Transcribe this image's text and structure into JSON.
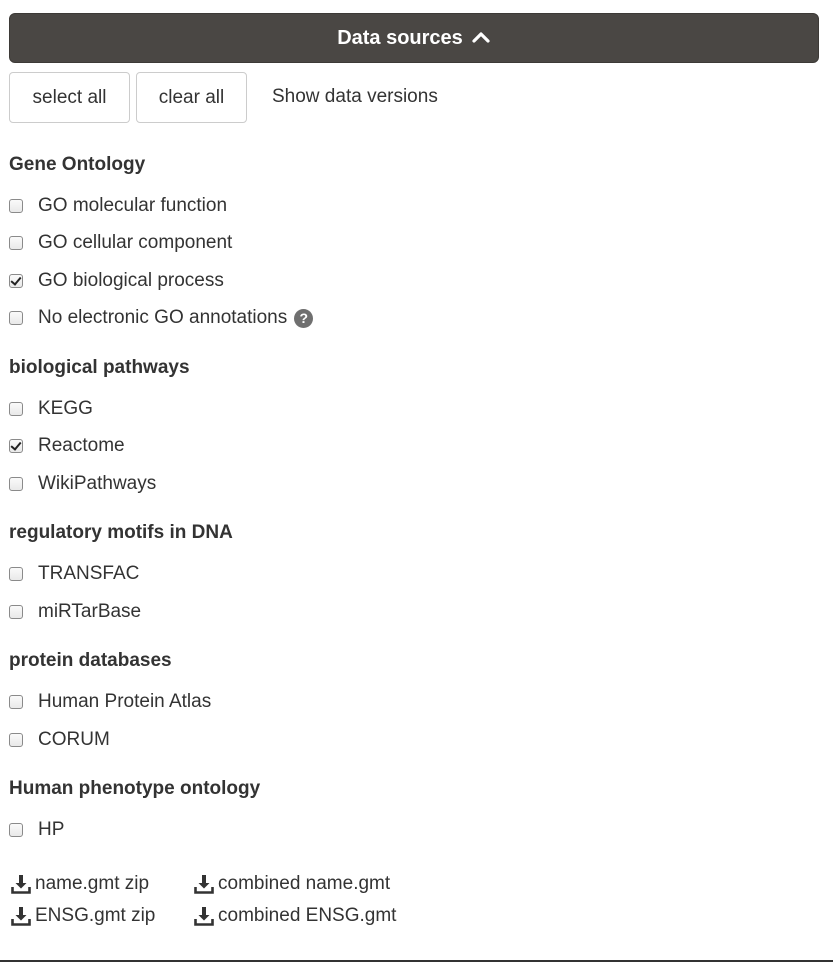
{
  "header": {
    "title": "Data sources",
    "toggle_icon": "chevron-up-icon"
  },
  "controls": {
    "select_all_label": "select all",
    "clear_all_label": "clear all",
    "versions_label": "Show data versions"
  },
  "groups": [
    {
      "title": "Gene Ontology",
      "options": [
        {
          "label": "GO molecular function",
          "checked": false
        },
        {
          "label": "GO cellular component",
          "checked": false
        },
        {
          "label": "GO biological process",
          "checked": true
        },
        {
          "label": "No electronic GO annotations",
          "checked": false,
          "help_icon": "question-circle-icon"
        }
      ]
    },
    {
      "title": "biological pathways",
      "options": [
        {
          "label": "KEGG",
          "checked": false
        },
        {
          "label": "Reactome",
          "checked": true
        },
        {
          "label": "WikiPathways",
          "checked": false
        }
      ]
    },
    {
      "title": "regulatory motifs in DNA",
      "options": [
        {
          "label": "TRANSFAC",
          "checked": false
        },
        {
          "label": "miRTarBase",
          "checked": false
        }
      ]
    },
    {
      "title": "protein databases",
      "options": [
        {
          "label": "Human Protein Atlas",
          "checked": false
        },
        {
          "label": "CORUM",
          "checked": false
        }
      ]
    },
    {
      "title": "Human phenotype ontology",
      "options": [
        {
          "label": "HP",
          "checked": false
        }
      ]
    }
  ],
  "downloads": {
    "icon": "download-icon",
    "name_zip": "name.gmt zip",
    "combined_name": "combined name.gmt",
    "ensg_zip": "ENSG.gmt zip",
    "combined_ensg": "combined ENSG.gmt"
  },
  "colors": {
    "header_bg": "#4a4744",
    "text": "#333333",
    "help_icon": "#6f6f6f"
  }
}
